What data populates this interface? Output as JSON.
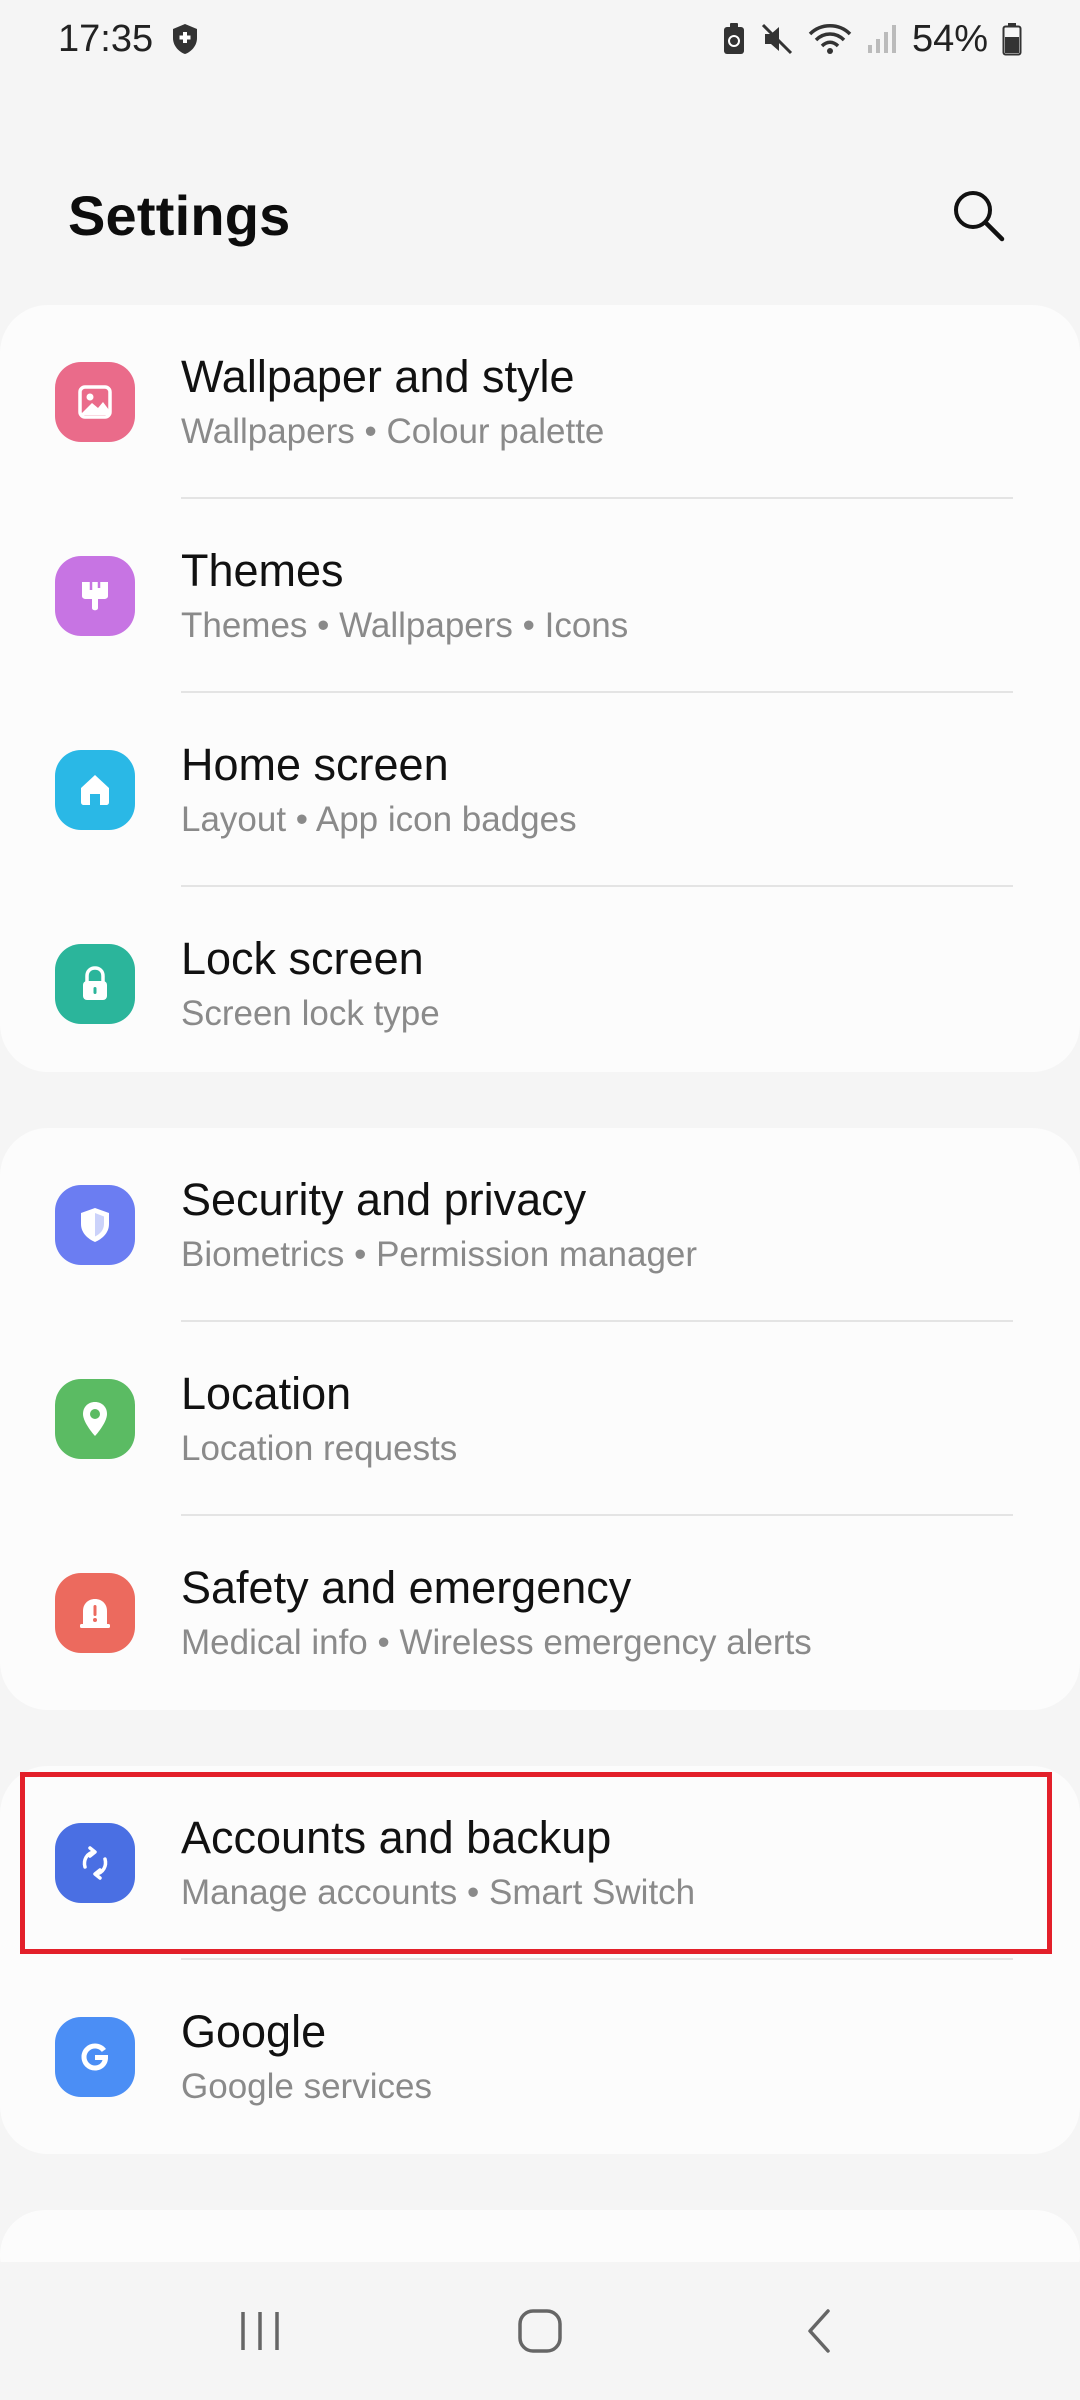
{
  "status_bar": {
    "time": "17:35",
    "battery": "54%",
    "icons": [
      "shield-icon",
      "battery-saver-icon",
      "mute-icon",
      "wifi-icon",
      "signal-icon",
      "battery-icon"
    ]
  },
  "header": {
    "title": "Settings",
    "search_icon": "search-icon"
  },
  "groups": [
    {
      "items": [
        {
          "title": "Wallpaper and style",
          "subtitle": "Wallpapers  •  Colour palette",
          "icon": "wallpaper-icon",
          "color": "#ea6b8a"
        },
        {
          "title": "Themes",
          "subtitle": "Themes  •  Wallpapers  •  Icons",
          "icon": "themes-icon",
          "color": "#c774e3"
        },
        {
          "title": "Home screen",
          "subtitle": "Layout  •  App icon badges",
          "icon": "home-icon",
          "color": "#2ab8e6"
        },
        {
          "title": "Lock screen",
          "subtitle": "Screen lock type",
          "icon": "lock-icon",
          "color": "#2bb59b"
        }
      ]
    },
    {
      "items": [
        {
          "title": "Security and privacy",
          "subtitle": "Biometrics  •  Permission manager",
          "icon": "shield-icon",
          "color": "#6b7df2"
        },
        {
          "title": "Location",
          "subtitle": "Location requests",
          "icon": "location-pin-icon",
          "color": "#5bbb63"
        },
        {
          "title": "Safety and emergency",
          "subtitle": "Medical info  •  Wireless emergency alerts",
          "icon": "emergency-icon",
          "color": "#ec6a5e"
        }
      ]
    },
    {
      "items": [
        {
          "title": "Accounts and backup",
          "subtitle": "Manage accounts  •  Smart Switch",
          "icon": "sync-icon",
          "color": "#4a6fe3"
        },
        {
          "title": "Google",
          "subtitle": "Google services",
          "icon": "google-icon",
          "color": "#4b8ef5"
        }
      ]
    }
  ],
  "highlight": {
    "target": "Accounts and backup",
    "color": "#e3202a"
  },
  "nav_bar": {
    "buttons": [
      "recents-icon",
      "home-nav-icon",
      "back-icon"
    ]
  }
}
